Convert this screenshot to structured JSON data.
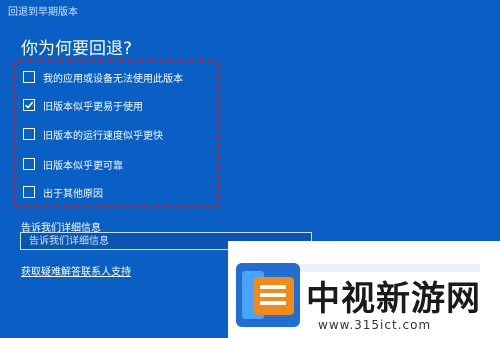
{
  "window": {
    "title": "回退到早期版本"
  },
  "heading": "你为何要回退?",
  "options": [
    {
      "label": "我的应用或设备无法使用此版本",
      "checked": false
    },
    {
      "label": "旧版本似乎更易于使用",
      "checked": true
    },
    {
      "label": "旧版本的运行速度似乎更快",
      "checked": false
    },
    {
      "label": "旧版本似乎更可靠",
      "checked": false
    },
    {
      "label": "出于其他原因",
      "checked": false
    }
  ],
  "details": {
    "label": "告诉我们详细信息",
    "placeholder": "告诉我们详细信息"
  },
  "help_link": "获取疑难解答联系人支持",
  "watermark": {
    "brand": "中视新游网",
    "url": "www.315ict.com"
  },
  "colors": {
    "background": "#0a5fc4",
    "highlight_border": "#c0202a"
  }
}
